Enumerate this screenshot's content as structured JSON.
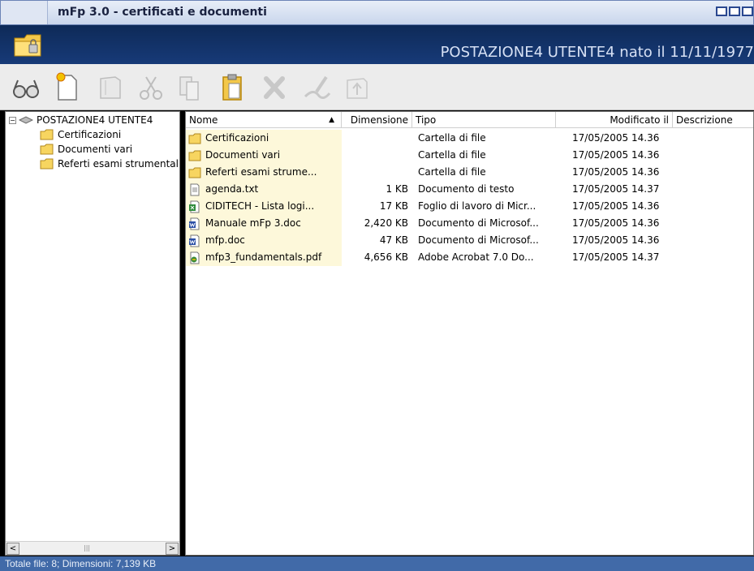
{
  "window": {
    "title": "mFp 3.0 - certificati e documenti"
  },
  "banner": {
    "user_info": "POSTAZIONE4 UTENTE4 nato il 11/11/1977"
  },
  "toolbar": {
    "buttons": [
      {
        "icon": "glasses-icon"
      },
      {
        "icon": "new-document-icon"
      },
      {
        "icon": "open-folder-icon"
      },
      {
        "icon": "scissors-icon"
      },
      {
        "icon": "copy-icon"
      },
      {
        "icon": "paste-icon"
      },
      {
        "icon": "delete-icon"
      },
      {
        "icon": "signature-icon"
      },
      {
        "icon": "up-arrow-icon"
      }
    ]
  },
  "tree": {
    "root": "POSTAZIONE4 UTENTE4",
    "children": [
      "Certificazioni",
      "Documenti vari",
      "Referti esami strumentali"
    ]
  },
  "list": {
    "columns": {
      "name": "Nome",
      "size": "Dimensione",
      "type": "Tipo",
      "modified": "Modificato il",
      "description": "Descrizione"
    },
    "rows": [
      {
        "name": "Certificazioni",
        "size": "",
        "type": "Cartella di file",
        "modified": "17/05/2005 14.36",
        "icon": "folder-icon"
      },
      {
        "name": "Documenti vari",
        "size": "",
        "type": "Cartella di file",
        "modified": "17/05/2005 14.36",
        "icon": "folder-icon"
      },
      {
        "name": "Referti esami strume...",
        "size": "",
        "type": "Cartella di file",
        "modified": "17/05/2005 14.36",
        "icon": "folder-icon"
      },
      {
        "name": "agenda.txt",
        "size": "1 KB",
        "type": "Documento di testo",
        "modified": "17/05/2005 14.37",
        "icon": "text-file-icon"
      },
      {
        "name": "CIDITECH - Lista logi...",
        "size": "17 KB",
        "type": "Foglio di lavoro di Micr...",
        "modified": "17/05/2005 14.36",
        "icon": "excel-file-icon"
      },
      {
        "name": "Manuale mFp 3.doc",
        "size": "2,420 KB",
        "type": "Documento di Microsof...",
        "modified": "17/05/2005 14.36",
        "icon": "word-file-icon"
      },
      {
        "name": "mfp.doc",
        "size": "47 KB",
        "type": "Documento di Microsof...",
        "modified": "17/05/2005 14.36",
        "icon": "word-file-icon"
      },
      {
        "name": "mfp3_fundamentals.pdf",
        "size": "4,656 KB",
        "type": "Adobe Acrobat 7.0 Do...",
        "modified": "17/05/2005 14.37",
        "icon": "pdf-file-icon"
      }
    ]
  },
  "status": {
    "text": "Totale file: 8; Dimensioni: 7,139 KB"
  },
  "colors": {
    "banner": "#0e2a58",
    "statusbar": "#416aa8",
    "name_highlight": "#fdf8da"
  }
}
